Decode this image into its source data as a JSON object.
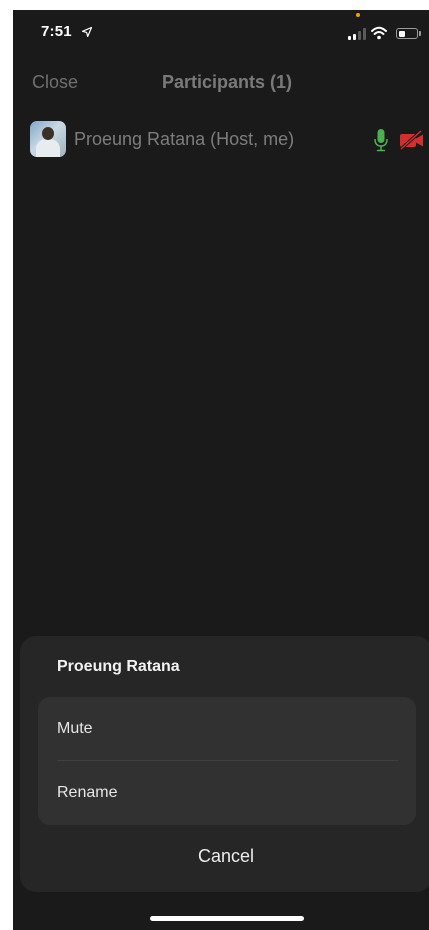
{
  "status_bar": {
    "time": "7:51",
    "signal_bars_active": 2,
    "signal_bars_total": 4,
    "battery_level": 0.35
  },
  "header": {
    "close_label": "Close",
    "title": "Participants (1)"
  },
  "participants": [
    {
      "name": "Proeung Ratana (Host, me)",
      "mic": "on",
      "video": "off"
    }
  ],
  "action_sheet": {
    "title": "Proeung Ratana",
    "options": [
      {
        "label": "Mute"
      },
      {
        "label": "Rename"
      }
    ],
    "cancel_label": "Cancel"
  },
  "icons": {
    "location": "location-arrow-icon",
    "signal": "cellular-signal-icon",
    "wifi": "wifi-icon",
    "battery": "battery-icon",
    "mic": "microphone-icon",
    "video": "video-off-icon"
  },
  "colors": {
    "background": "#1a1a1a",
    "sheet": "#262626",
    "sheet_group": "#313131",
    "mic_active": "#4caf50",
    "video_off": "#d32f2f",
    "privacy_dot": "#f59e0b"
  }
}
